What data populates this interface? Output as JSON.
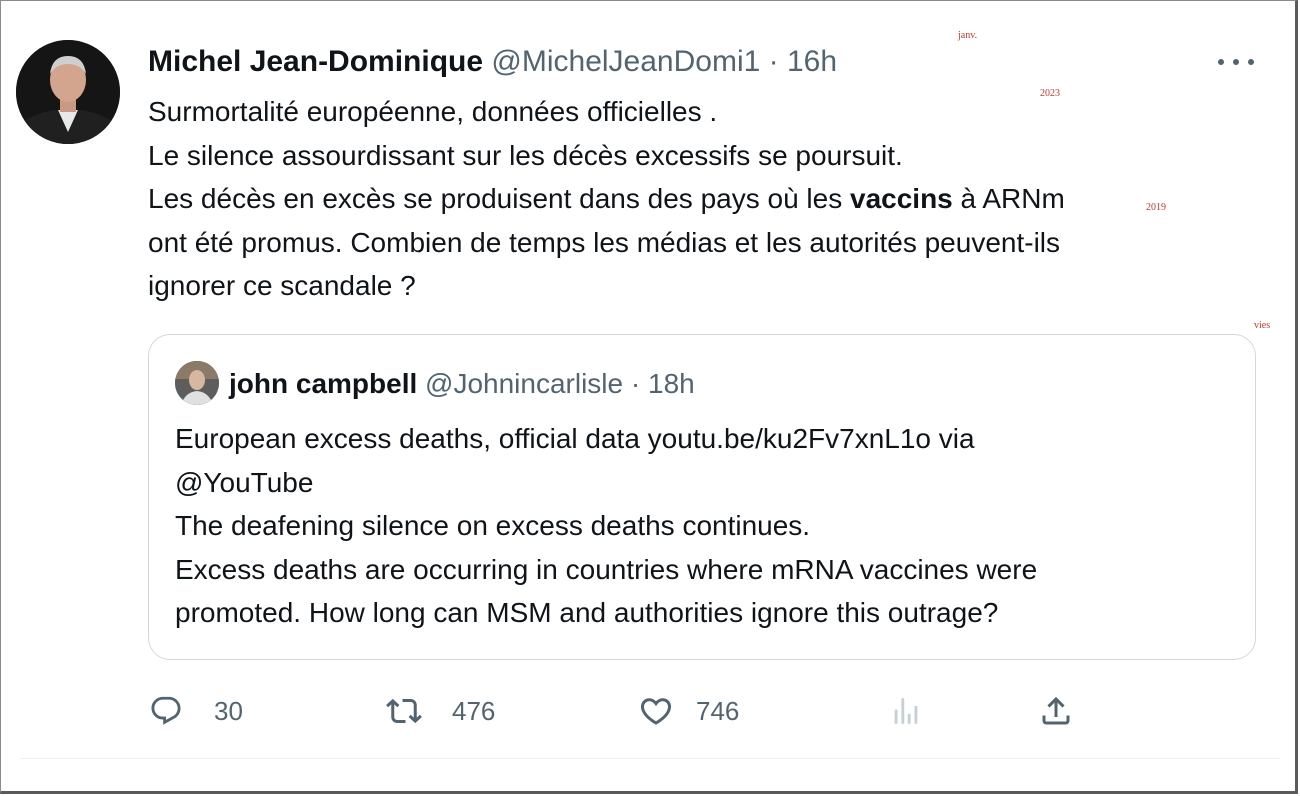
{
  "tweet": {
    "author_name": "Michel Jean-Dominique",
    "author_handle": "@MichelJeanDomi1",
    "separator": "·",
    "time": "16h",
    "text_lines": [
      "Surmortalité européenne, données officielles .",
      "Le silence assourdissant sur les décès excessifs se poursuit.",
      "Les décès en excès se produisent dans des pays où les ",
      "ont été promus. Combien de temps les médias et les autorités peuvent-ils",
      "ignorer ce scandale ?"
    ],
    "bold_word": "vaccins",
    "line3_tail": " à ARNm"
  },
  "quoted_tweet": {
    "author_name": "john campbell",
    "author_handle": "@Johnincarlisle",
    "separator": "·",
    "time": "18h",
    "text_lines": [
      "European excess deaths, official data youtu.be/ku2Fv7xnL1o via",
      "@YouTube",
      "The deafening silence on excess deaths continues.",
      "Excess deaths are occurring in countries where mRNA vaccines were",
      "promoted. How long can MSM and authorities ignore this outrage?"
    ]
  },
  "actions": {
    "reply_count": "30",
    "retweet_count": "476",
    "like_count": "746"
  },
  "icons": {
    "more": "more-horizontal-icon",
    "reply": "reply-icon",
    "retweet": "retweet-icon",
    "like": "heart-icon",
    "views": "views-icon",
    "share": "share-icon"
  },
  "colors": {
    "text": "#0f1419",
    "secondary": "#536471",
    "border": "#cfd9de"
  },
  "annotations": [
    "janv.",
    "2023",
    "2019",
    "vies"
  ]
}
